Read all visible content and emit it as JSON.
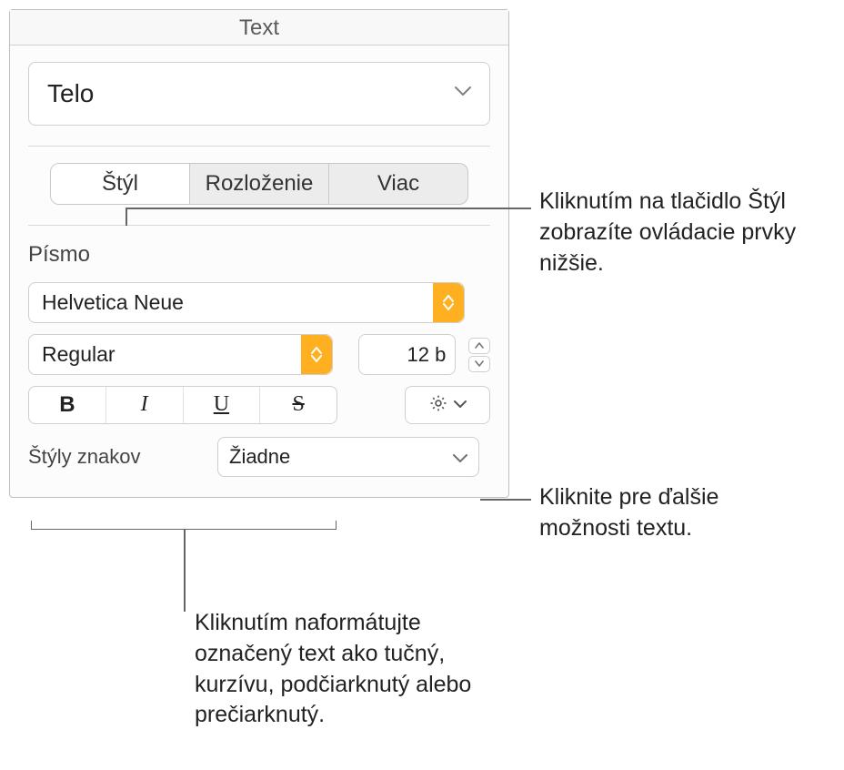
{
  "panel": {
    "title": "Text",
    "paragraphStyle": "Telo",
    "tabs": {
      "style": "Štýl",
      "layout": "Rozloženie",
      "more": "Viac"
    },
    "font": {
      "label": "Písmo",
      "family": "Helvetica Neue",
      "weight": "Regular",
      "size": "12 b",
      "charStylesLabel": "Štýly znakov",
      "charStyleValue": "Žiadne"
    },
    "bius": {
      "bold": "B",
      "italic": "I",
      "underline": "U",
      "strike": "S"
    }
  },
  "callouts": {
    "tabs": "Kliknutím na tlačidlo Štýl zobrazíte ovládacie prvky nižšie.",
    "gear": "Kliknite pre ďalšie možnosti textu.",
    "bius": "Kliknutím naformátujte označený text ako tučný, kurzívu, podčiarknutý alebo prečiarknutý."
  }
}
